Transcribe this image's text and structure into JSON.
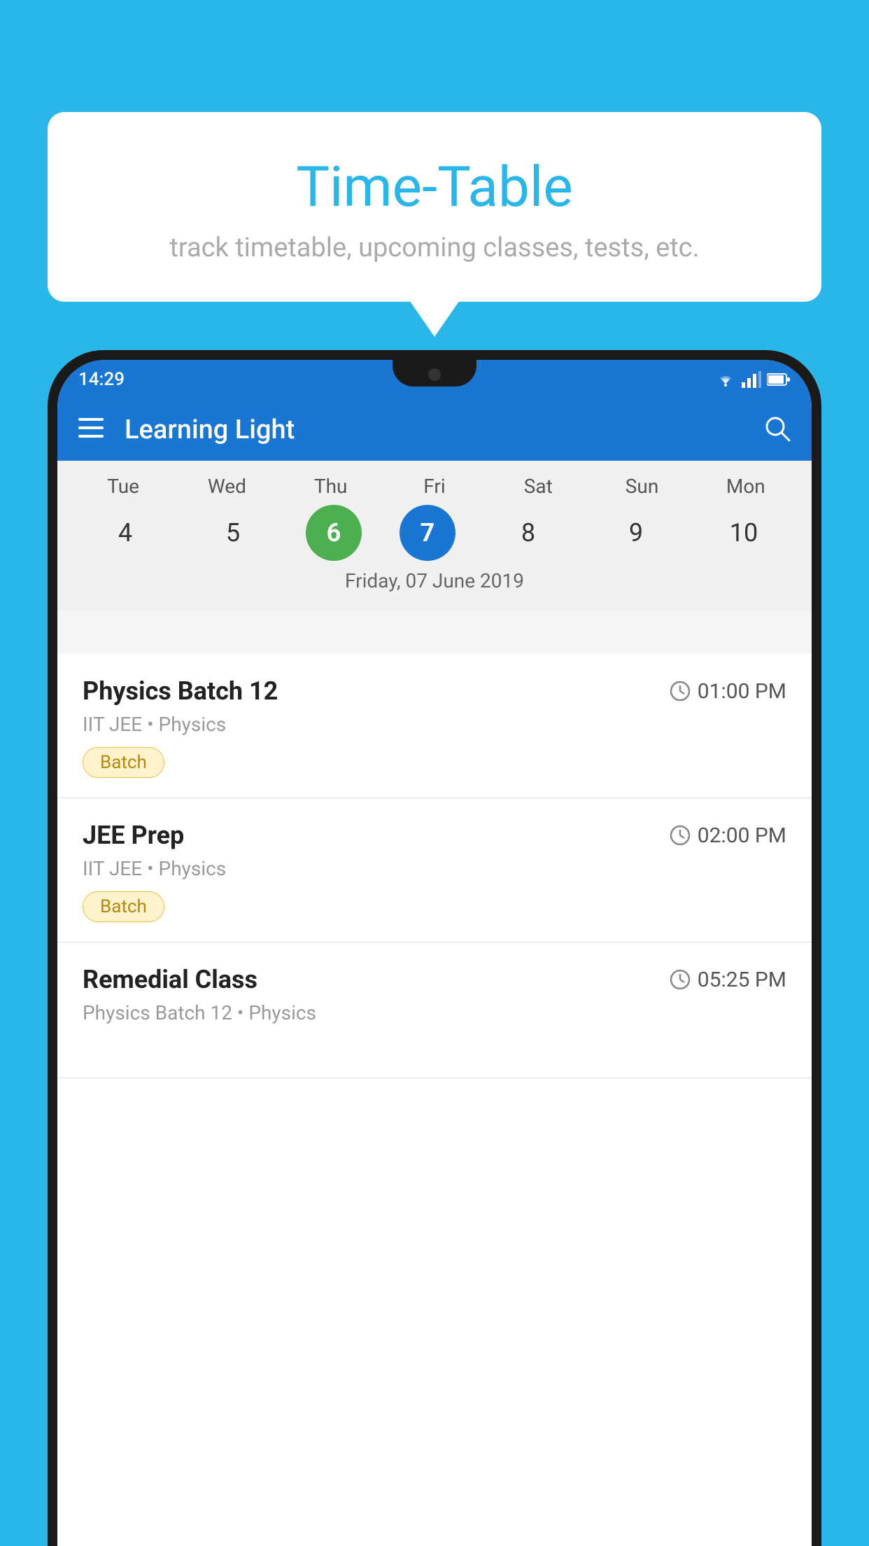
{
  "background_color": "#29B6E8",
  "bubble": {
    "title": "Time-Table",
    "subtitle": "track timetable, upcoming classes, tests, etc."
  },
  "phone": {
    "status_bar": {
      "time": "14:29"
    },
    "app_header": {
      "title": "Learning Light",
      "menu_icon": "☰",
      "search_icon": "🔍"
    },
    "calendar": {
      "days": [
        "Tue",
        "Wed",
        "Thu",
        "Fri",
        "Sat",
        "Sun",
        "Mon"
      ],
      "dates": [
        "4",
        "5",
        "6",
        "7",
        "8",
        "9",
        "10"
      ],
      "today_index": 2,
      "selected_index": 3,
      "selected_label": "Friday, 07 June 2019"
    },
    "classes": [
      {
        "name": "Physics Batch 12",
        "time": "01:00 PM",
        "subject": "IIT JEE • Physics",
        "tag": "Batch"
      },
      {
        "name": "JEE Prep",
        "time": "02:00 PM",
        "subject": "IIT JEE • Physics",
        "tag": "Batch"
      },
      {
        "name": "Remedial Class",
        "time": "05:25 PM",
        "subject": "Physics Batch 12 • Physics",
        "tag": ""
      }
    ]
  }
}
